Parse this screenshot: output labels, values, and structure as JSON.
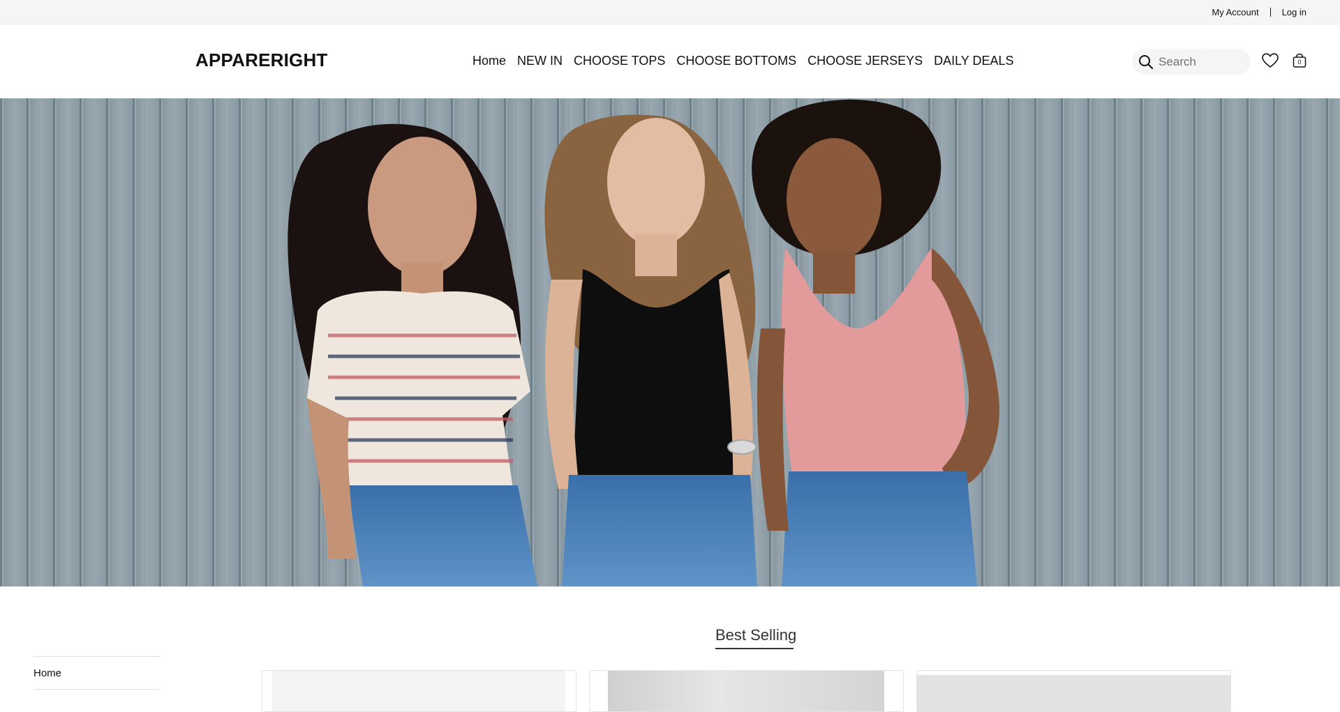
{
  "topbar": {
    "my_account": "My Account",
    "log_in": "Log in"
  },
  "header": {
    "logo": "APPARERIGHT",
    "nav": [
      "Home",
      "NEW IN",
      "CHOOSE TOPS",
      "CHOOSE BOTTOMS",
      "CHOOSE JERSEYS",
      "DAILY DEALS"
    ],
    "search_placeholder": "Search",
    "bag_count": "0",
    "icons": {
      "search": "search-icon",
      "favorites": "heart-icon",
      "bag": "shopping-bag-icon"
    }
  },
  "hero": {
    "image": "three women leaning against a grey wooden wall wearing tops and denim",
    "colors": {
      "wall": "#8a9aa3",
      "tank_black": "#0d0d0d",
      "tank_pink": "#e39a9a",
      "denim": "#3f78b8"
    }
  },
  "main": {
    "section_title": "Best Selling",
    "sidebar": [
      "Home"
    ],
    "products": [
      {
        "image": "product-image"
      },
      {
        "image": "product-image"
      },
      {
        "image": "product-image"
      }
    ]
  }
}
